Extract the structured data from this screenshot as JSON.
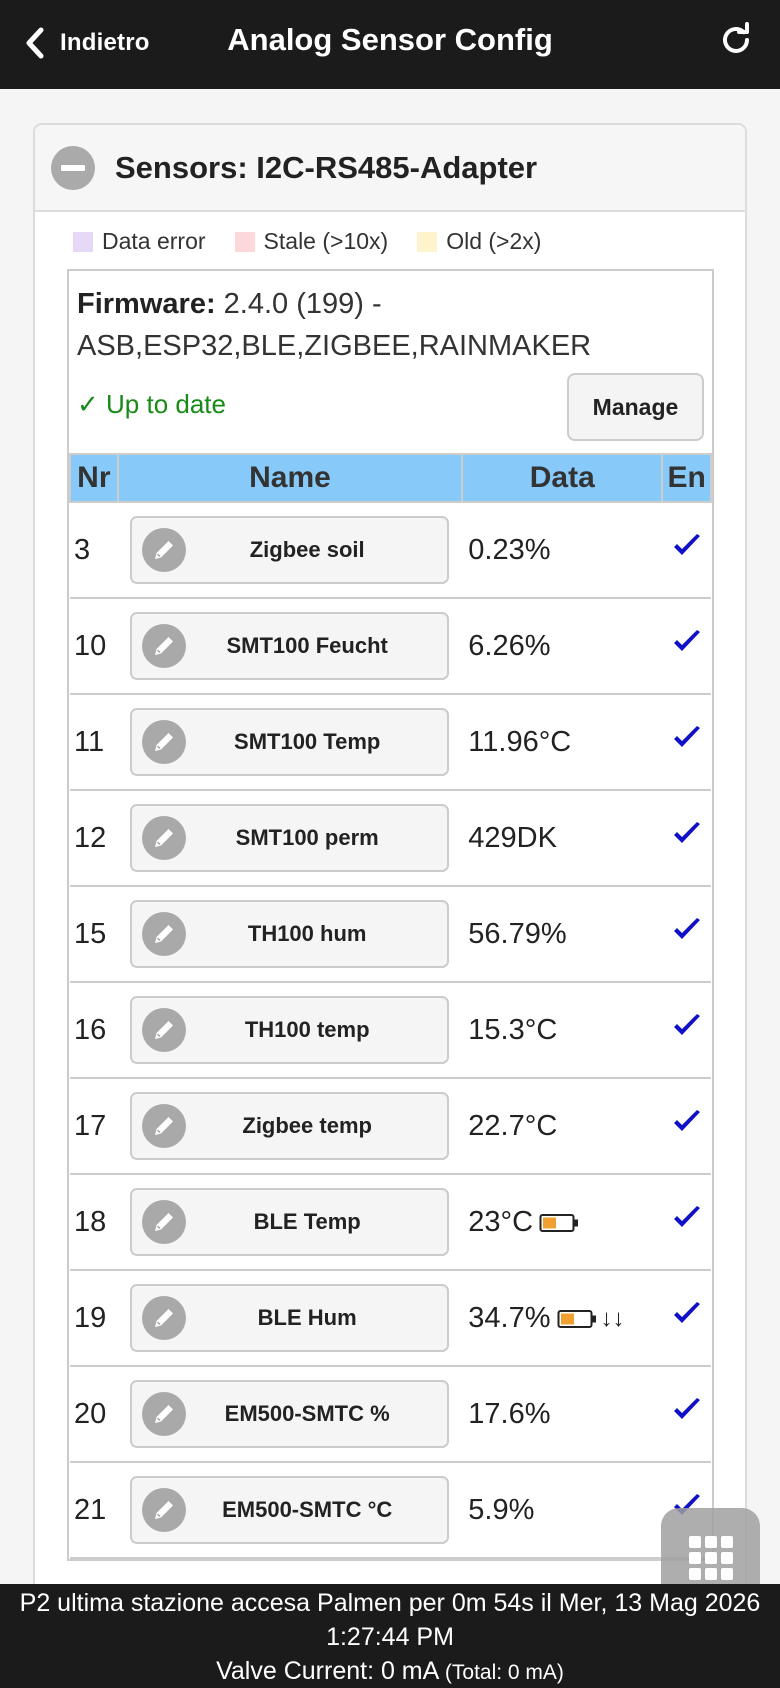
{
  "header": {
    "back_label": "Indietro",
    "title": "Analog Sensor Config"
  },
  "panel": {
    "title": "Sensors: I2C-RS485-Adapter"
  },
  "legend": [
    {
      "label": "Data error",
      "color": "#e6d9f7"
    },
    {
      "label": "Stale (>10x)",
      "color": "#fdd8da"
    },
    {
      "label": "Old (>2x)",
      "color": "#fdf3cc"
    }
  ],
  "firmware": {
    "label": "Firmware:",
    "version": "2.4.0 (199) -",
    "features": "ASB,ESP32,BLE,ZIGBEE,RAINMAKER",
    "status": "✓ Up to date",
    "manage_label": "Manage"
  },
  "table": {
    "headers": {
      "nr": "Nr",
      "name": "Name",
      "data": "Data",
      "en": "En"
    },
    "rows": [
      {
        "nr": "3",
        "name": "Zigbee soil",
        "data": "0.23%",
        "enabled": true
      },
      {
        "nr": "10",
        "name": "SMT100 Feucht",
        "data": "6.26%",
        "enabled": true
      },
      {
        "nr": "11",
        "name": "SMT100 Temp",
        "data": "11.96°C",
        "enabled": true
      },
      {
        "nr": "12",
        "name": "SMT100 perm",
        "data": "429DK",
        "enabled": true
      },
      {
        "nr": "15",
        "name": "TH100 hum",
        "data": "56.79%",
        "enabled": true
      },
      {
        "nr": "16",
        "name": "TH100 temp",
        "data": "15.3°C",
        "enabled": true
      },
      {
        "nr": "17",
        "name": "Zigbee temp",
        "data": "22.7°C",
        "enabled": true
      },
      {
        "nr": "18",
        "name": "BLE Temp",
        "data": "23°C",
        "battery": "low-battery-icon",
        "enabled": true
      },
      {
        "nr": "19",
        "name": "BLE Hum",
        "data": "34.7%",
        "battery": "low-battery-icon",
        "trend": "↓↓",
        "enabled": true
      },
      {
        "nr": "20",
        "name": "EM500-SMTC %",
        "data": "17.6%",
        "enabled": true
      },
      {
        "nr": "21",
        "name": "EM500-SMTC °C",
        "data": "5.9%",
        "enabled": true
      }
    ]
  },
  "footer": {
    "line1": "P2 ultima stazione accesa Palmen per 0m 54s il Mer, 13 Mag 2026 1:27:44 PM",
    "valve_label": "Valve Current: 0 mA",
    "valve_total": "(Total: 0 mA)"
  },
  "colors": {
    "header_bg": "#1b1b1b",
    "table_header_bg": "#87cafa",
    "check": "#1010c8",
    "ok_text": "#178a17",
    "battery_fill": "#f0a030"
  }
}
